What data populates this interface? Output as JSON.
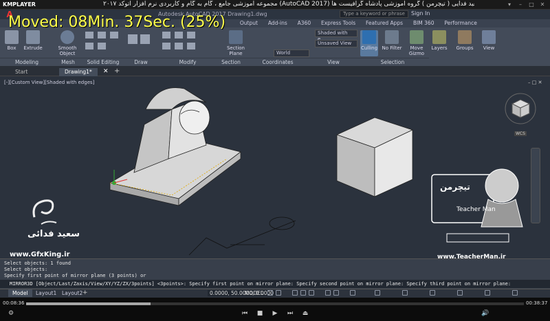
{
  "player": {
    "logo": "KMPLAYER",
    "caption": "مجموعه آموزشی جامع ، گام به گام و کاربردی نرم افزار  اتوکد ۲۰۱۷ (AutoCAD 2017)  مدرس : سعید فدایی ( تیچرمن ) گروه آموزشی پادشاه گرافیست ها",
    "time_elapsed": "00:08:36",
    "time_total": "00:38:37",
    "progress": 0.25,
    "controls": [
      "prev",
      "stop",
      "play",
      "next",
      "eject"
    ]
  },
  "overlay": {
    "text": "Moved: 08Min. 37Sec. (25%)"
  },
  "acad": {
    "title": "Autodesk AutoCAD 2017    Drawing1.dwg",
    "search_placeholder": "Type a keyword or phrase",
    "signin": "Sign In",
    "ribbon_tabs": [
      "Output",
      "Add-ins",
      "A360",
      "Express Tools",
      "Featured Apps",
      "BIM 360",
      "Performance"
    ],
    "ribbon_buttons": [
      {
        "label": "Box",
        "panel": "Modeling"
      },
      {
        "label": "Extrude",
        "panel": "Modeling"
      },
      {
        "label": "Smooth Object",
        "panel": "Mesh"
      },
      {
        "label": "Section Plane",
        "panel": "Section"
      },
      {
        "label": "Culling",
        "panel": "Selection"
      },
      {
        "label": "No Filter",
        "panel": "Selection"
      },
      {
        "label": "Move Gizmo",
        "panel": "Selection"
      },
      {
        "label": "Layers",
        "panel": ""
      },
      {
        "label": "Groups",
        "panel": ""
      },
      {
        "label": "View",
        "panel": ""
      }
    ],
    "panels": [
      "Modeling",
      "Mesh",
      "Solid Editing",
      "Draw",
      "Modify",
      "Section",
      "Coordinates",
      "View",
      "Selection"
    ],
    "visual_style": "Shaded with e...",
    "view_state": "Unsaved View",
    "ucs": "World",
    "file_tabs": [
      "Start",
      "Drawing1*"
    ],
    "viewport_label": "[-][Custom View][Shaded with edges]",
    "wcs": "WCS",
    "command_history": [
      "Select objects: 1 found",
      "Select objects:",
      "Specify first point of mirror plane (3 points) or"
    ],
    "command_input": "MIRROR3D [Object/Last/Zaxis/View/XY/YZ/ZX/3points] <3points>:  Specify first point on mirror plane: Specify second point on mirror plane: Specify third point on mirror plane:",
    "layout_tabs": [
      "Model",
      "Layout1",
      "Layout2"
    ],
    "coordinates": "0.0000, 50.0000, 0.0000",
    "model_label": "MODEL"
  },
  "watermarks": {
    "author": "سعید فدائی",
    "site_left": "www.GfxKing.ir",
    "tm_logo": "تیچرمن",
    "tm_name": "Teacher Man",
    "site_right": "www.TeacherMan.ir"
  },
  "colors": {
    "overlay": "#ffff4a",
    "viewport": "#2b323d",
    "ribbon": "#434b59"
  }
}
